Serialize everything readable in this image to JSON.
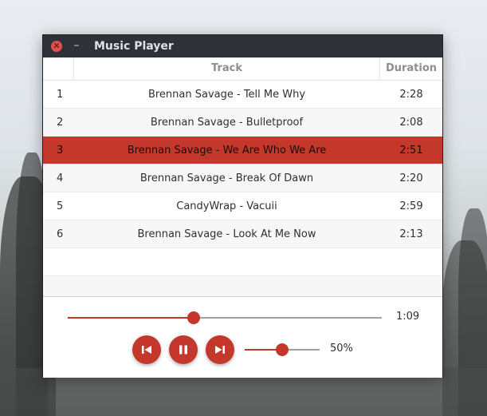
{
  "window": {
    "title": "Music Player",
    "close_glyph": "✕",
    "minimize_glyph": "–"
  },
  "table": {
    "columns": {
      "track": "Track",
      "duration": "Duration"
    },
    "rows": [
      {
        "num": "1",
        "track": "Brennan Savage - Tell Me Why",
        "duration": "2:28"
      },
      {
        "num": "2",
        "track": "Brennan Savage - Bulletproof",
        "duration": "2:08"
      },
      {
        "num": "3",
        "track": "Brennan Savage - We Are Who We Are",
        "duration": "2:51",
        "selected": true
      },
      {
        "num": "4",
        "track": "Brennan Savage - Break Of Dawn",
        "duration": "2:20"
      },
      {
        "num": "5",
        "track": "CandyWrap - Vacuii",
        "duration": "2:59"
      },
      {
        "num": "6",
        "track": "Brennan Savage - Look At Me Now",
        "duration": "2:13"
      }
    ]
  },
  "player": {
    "elapsed": "1:09",
    "progress_fraction": 0.4,
    "volume_label": "50%",
    "volume_fraction": 0.5
  },
  "colors": {
    "accent": "#c4382c",
    "titlebar": "#2e3137",
    "close": "#e2504b"
  },
  "icons": {
    "close": "close-icon",
    "minimize": "minimize-icon",
    "previous": "skip-previous-icon",
    "pause": "pause-icon",
    "next": "skip-next-icon"
  }
}
